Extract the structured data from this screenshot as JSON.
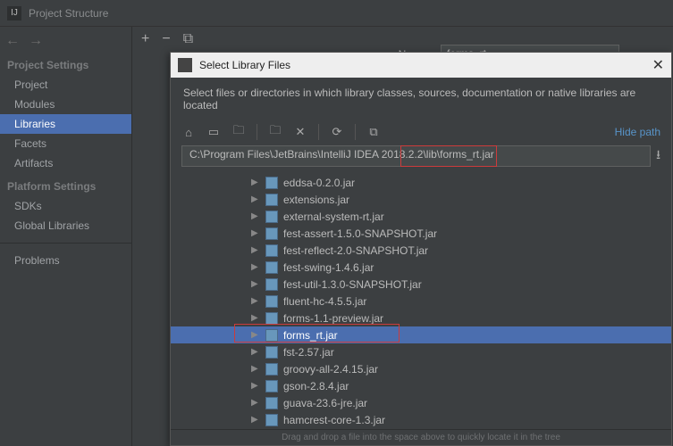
{
  "window": {
    "title": "Project Structure"
  },
  "sidebar": {
    "headings": {
      "project": "Project Settings",
      "platform": "Platform Settings"
    },
    "project_items": [
      "Project",
      "Modules",
      "Libraries",
      "Facets",
      "Artifacts"
    ],
    "platform_items": [
      "SDKs",
      "Global Libraries"
    ],
    "problems": "Problems"
  },
  "form": {
    "name_label": "Name:",
    "name_value": "forms_rt"
  },
  "dialog": {
    "title": "Select Library Files",
    "info": "Select files or directories in which library classes, sources, documentation or native libraries are located",
    "hide_path": "Hide path",
    "path": "C:\\Program Files\\JetBrains\\IntelliJ IDEA 2018.2.2\\lib\\forms_rt.jar",
    "files": [
      "eddsa-0.2.0.jar",
      "extensions.jar",
      "external-system-rt.jar",
      "fest-assert-1.5.0-SNAPSHOT.jar",
      "fest-reflect-2.0-SNAPSHOT.jar",
      "fest-swing-1.4.6.jar",
      "fest-util-1.3.0-SNAPSHOT.jar",
      "fluent-hc-4.5.5.jar",
      "forms-1.1-preview.jar",
      "forms_rt.jar",
      "fst-2.57.jar",
      "groovy-all-2.4.15.jar",
      "gson-2.8.4.jar",
      "guava-23.6-jre.jar",
      "hamcrest-core-1.3.jar"
    ],
    "selected_index": 9,
    "drag_hint": "Drag and drop a file into the space above to quickly locate it in the tree"
  },
  "icons": {
    "home": "⌂",
    "monitor": "▭",
    "folder": "🗀",
    "new-folder": "🗀",
    "delete": "✕",
    "refresh": "⟳",
    "show-hidden": "⧉",
    "plus": "+",
    "minus": "−",
    "copy": "⧉",
    "back": "←",
    "forward": "→",
    "download": "⭳",
    "tree-arrow": "▶"
  }
}
